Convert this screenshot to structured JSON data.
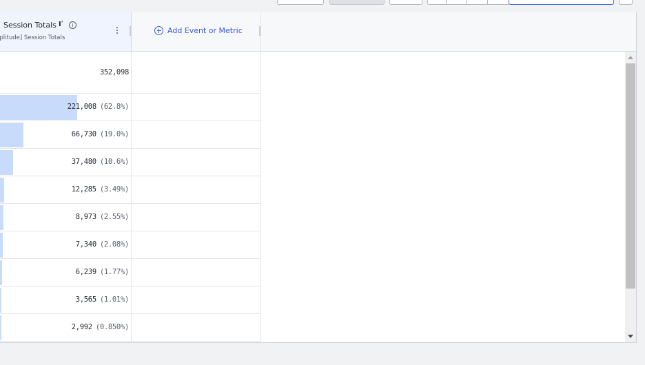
{
  "header": {
    "metric_title": "Session Totals",
    "metric_title_suffix": "Iʹ",
    "metric_subtitle": "nplitude] Session Totals",
    "info_symbol": "i",
    "add_metric_label": "Add Event or Metric"
  },
  "total_value": "352,098",
  "rows": [
    {
      "value": "221,008",
      "pct": "(62.8%)",
      "bar_fraction": 0.628
    },
    {
      "value": "66,730",
      "pct": "(19.0%)",
      "bar_fraction": 0.19
    },
    {
      "value": "37,480",
      "pct": "(10.6%)",
      "bar_fraction": 0.106
    },
    {
      "value": "12,285",
      "pct": "(3.49%)",
      "bar_fraction": 0.0349
    },
    {
      "value": "8,973",
      "pct": "(2.55%)",
      "bar_fraction": 0.0255
    },
    {
      "value": "7,340",
      "pct": "(2.08%)",
      "bar_fraction": 0.0208
    },
    {
      "value": "6,239",
      "pct": "(1.77%)",
      "bar_fraction": 0.0177
    },
    {
      "value": "3,565",
      "pct": "(1.01%)",
      "bar_fraction": 0.0101
    },
    {
      "value": "2,992",
      "pct": "(0.850%)",
      "bar_fraction": 0.0085
    }
  ],
  "icons": {
    "info": "info-icon",
    "more": "kebab-menu-icon",
    "add": "plus-circle-icon"
  },
  "colors": {
    "accent": "#3a5bd9",
    "bar_fill": "#c9dbfb"
  }
}
